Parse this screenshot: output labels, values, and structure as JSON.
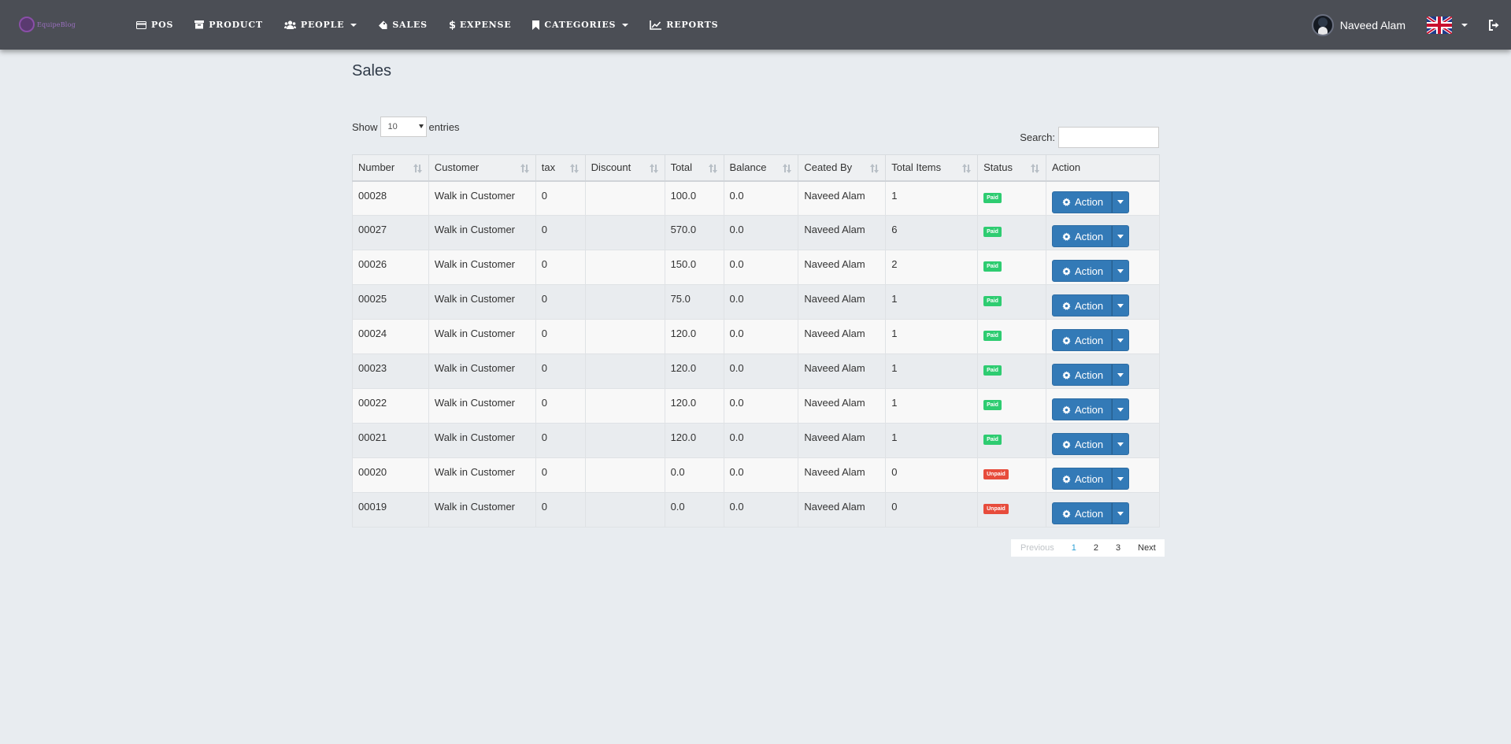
{
  "brand": {
    "logo_text": "EquipeBlog"
  },
  "nav": {
    "items": [
      {
        "icon": "credit-card-icon",
        "label": "POS"
      },
      {
        "icon": "archive-box-icon",
        "label": "PRODUCT"
      },
      {
        "icon": "users-icon",
        "label": "PEOPLE"
      },
      {
        "icon": "tag-icon",
        "label": "SALES"
      },
      {
        "icon": "dollar-icon",
        "label": "EXPENSE"
      },
      {
        "icon": "bookmark-icon",
        "label": "CATEGORIES"
      },
      {
        "icon": "line-chart-icon",
        "label": "REPORTS"
      }
    ],
    "user_name": "Naveed Alam",
    "language": "English (UK flag)"
  },
  "page": {
    "title": "Sales",
    "show_label": "Show",
    "entries_label": "entries",
    "entries_value": "10",
    "search_label": "Search:",
    "search_value": ""
  },
  "table": {
    "columns": [
      "Number",
      "Customer",
      "tax",
      "Discount",
      "Total",
      "Balance",
      "Ceated By",
      "Total Items",
      "Status",
      "Action"
    ],
    "action_label": "Action",
    "rows": [
      {
        "number": "00028",
        "customer": "Walk in Customer",
        "tax": "0",
        "discount": "",
        "total": "100.0",
        "balance": "0.0",
        "created_by": "Naveed Alam",
        "items": "1",
        "status": "Paid"
      },
      {
        "number": "00027",
        "customer": "Walk in Customer",
        "tax": "0",
        "discount": "",
        "total": "570.0",
        "balance": "0.0",
        "created_by": "Naveed Alam",
        "items": "6",
        "status": "Paid"
      },
      {
        "number": "00026",
        "customer": "Walk in Customer",
        "tax": "0",
        "discount": "",
        "total": "150.0",
        "balance": "0.0",
        "created_by": "Naveed Alam",
        "items": "2",
        "status": "Paid"
      },
      {
        "number": "00025",
        "customer": "Walk in Customer",
        "tax": "0",
        "discount": "",
        "total": "75.0",
        "balance": "0.0",
        "created_by": "Naveed Alam",
        "items": "1",
        "status": "Paid"
      },
      {
        "number": "00024",
        "customer": "Walk in Customer",
        "tax": "0",
        "discount": "",
        "total": "120.0",
        "balance": "0.0",
        "created_by": "Naveed Alam",
        "items": "1",
        "status": "Paid"
      },
      {
        "number": "00023",
        "customer": "Walk in Customer",
        "tax": "0",
        "discount": "",
        "total": "120.0",
        "balance": "0.0",
        "created_by": "Naveed Alam",
        "items": "1",
        "status": "Paid"
      },
      {
        "number": "00022",
        "customer": "Walk in Customer",
        "tax": "0",
        "discount": "",
        "total": "120.0",
        "balance": "0.0",
        "created_by": "Naveed Alam",
        "items": "1",
        "status": "Paid"
      },
      {
        "number": "00021",
        "customer": "Walk in Customer",
        "tax": "0",
        "discount": "",
        "total": "120.0",
        "balance": "0.0",
        "created_by": "Naveed Alam",
        "items": "1",
        "status": "Paid"
      },
      {
        "number": "00020",
        "customer": "Walk in Customer",
        "tax": "0",
        "discount": "",
        "total": "0.0",
        "balance": "0.0",
        "created_by": "Naveed Alam",
        "items": "0",
        "status": "Unpaid"
      },
      {
        "number": "00019",
        "customer": "Walk in Customer",
        "tax": "0",
        "discount": "",
        "total": "0.0",
        "balance": "0.0",
        "created_by": "Naveed Alam",
        "items": "0",
        "status": "Unpaid"
      }
    ]
  },
  "pagination": {
    "previous": "Previous",
    "pages": [
      "1",
      "2",
      "3"
    ],
    "current": "1",
    "next": "Next"
  },
  "colors": {
    "navbar": "#4b4e55",
    "background": "#e8ecf0",
    "primary_button": "#337ab7",
    "paid": "#2ecc71",
    "unpaid": "#e74c3c"
  }
}
